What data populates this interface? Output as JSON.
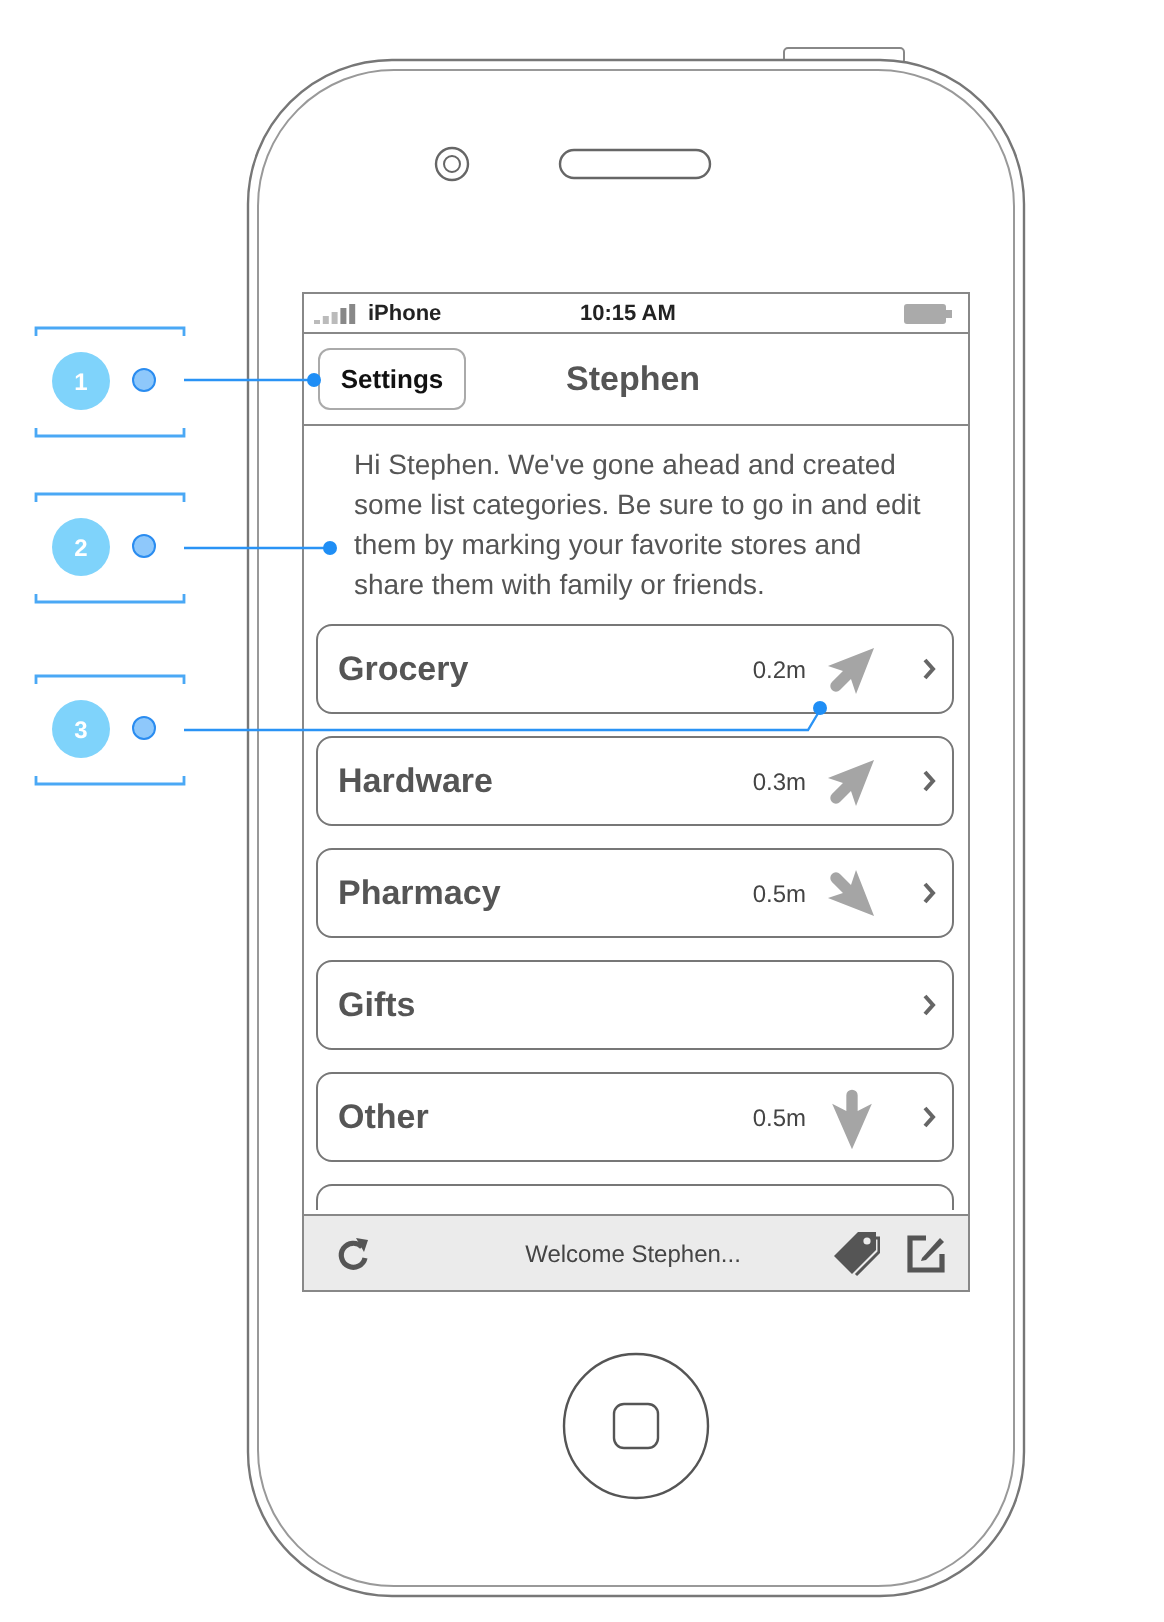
{
  "status_bar": {
    "carrier": "iPhone",
    "time": "10:15 AM"
  },
  "nav_bar": {
    "back_button": "Settings",
    "title": "Stephen"
  },
  "intro": "Hi Stephen. We've gone ahead and created some list categories. Be sure to go in and edit them by marking your favorite stores and share them with family or friends.",
  "categories": [
    {
      "label": "Grocery",
      "distance": "0.2m",
      "kind": "northeast"
    },
    {
      "label": "Hardware",
      "distance": "0.3m",
      "kind": "northeast"
    },
    {
      "label": "Pharmacy",
      "distance": "0.5m",
      "kind": "southeast"
    },
    {
      "label": "Gifts",
      "kind": "plain"
    },
    {
      "label": "Other",
      "distance": "0.5m",
      "kind": "south"
    }
  ],
  "toolbar": {
    "message": "Welcome Stephen..."
  },
  "annotations": [
    {
      "number": "1"
    },
    {
      "number": "2"
    },
    {
      "number": "3"
    }
  ]
}
